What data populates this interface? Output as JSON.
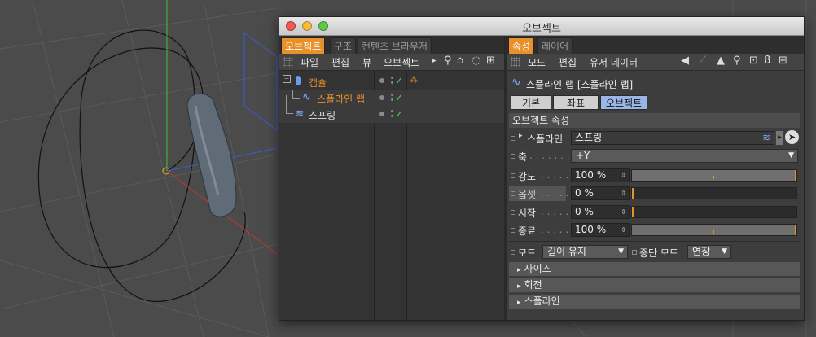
{
  "window": {
    "title": "오브젝트"
  },
  "left_panel": {
    "tabs": [
      "오브젝트",
      "구조",
      "컨텐츠 브라우저"
    ],
    "menu": [
      "파일",
      "편집",
      "뷰",
      "오브젝트"
    ],
    "tree": [
      {
        "name": "캡슐",
        "icon": "capsule-icon",
        "color": "#e8912b"
      },
      {
        "name": "스플라인 랩",
        "icon": "spline-wrap-icon",
        "color": "#e8912b"
      },
      {
        "name": "스프링",
        "icon": "spring-icon",
        "color": "#e0e0e0"
      }
    ]
  },
  "right_panel": {
    "tabs": [
      "속성",
      "레이어"
    ],
    "menu": [
      "모드",
      "편집",
      "유저 데이터"
    ],
    "object_title": "스플라인 랩 [스플라인 랩]",
    "subtabs": [
      "기본",
      "좌표",
      "오브젝트"
    ],
    "section": "오브젝트 속성",
    "props": {
      "spline_label": "스플라인",
      "spline_value": "스프링",
      "axis_label": "축",
      "axis_value": "+Y",
      "strength_label": "강도",
      "strength_value": "100 %",
      "strength_level": 1.0,
      "offset_label": "옵셋",
      "offset_value": "0 %",
      "offset_level": 0.0,
      "start_label": "시작",
      "start_value": "0 %",
      "start_level": 0.0,
      "end_label": "종료",
      "end_value": "100 %",
      "end_level": 1.0,
      "mode_label": "모드",
      "mode_value": "길이 유지",
      "endmode_label": "종단 모드",
      "endmode_value": "연장"
    },
    "groups": [
      "사이즈",
      "회전",
      "스플라인"
    ]
  },
  "colors": {
    "accent": "#e8912b",
    "active_subtab": "#9bb6e6",
    "check": "#57d35a"
  }
}
